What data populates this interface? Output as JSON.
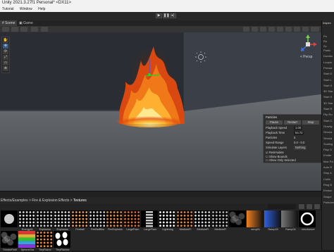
{
  "window": {
    "title": "Unity 2021.3.27f1 Personal* <DX11>"
  },
  "menu": [
    "Tutorial",
    "Window",
    "Help"
  ],
  "scene_tabs": [
    {
      "label": "Scene"
    },
    {
      "label": "Game"
    }
  ],
  "gizmo": {
    "view_label": "< Persp"
  },
  "particles_panel": {
    "title": "Particles",
    "buttons": [
      "Pause",
      "Restart",
      "Stop"
    ],
    "rows": [
      {
        "label": "Playback Speed",
        "value": "1.00"
      },
      {
        "label": "Playback Time",
        "value": "54.72"
      },
      {
        "label": "Particles",
        "value": "5"
      },
      {
        "label": "Speed Range",
        "value": "0.0 - 0.0"
      },
      {
        "label": "Simulate Layers",
        "value": "Nothing"
      }
    ],
    "checks": [
      {
        "label": "Resimulate",
        "checked": true
      },
      {
        "label": "Show Bounds",
        "checked": false
      },
      {
        "label": "Show Only Selected",
        "checked": false
      }
    ]
  },
  "inspector": {
    "tab": "Inspec",
    "items": [
      "Po",
      "Ro",
      "Sc",
      "Partic",
      "Duratio",
      "Loopin",
      "Prewar",
      "Start D",
      "Start L",
      "Start S",
      "3D Star",
      "Start S",
      "3D Star",
      "Start R",
      "Flip Ro",
      "Start C",
      "Gravity",
      "Simula",
      "Simula",
      "Scaling",
      "Play O",
      "Emitte",
      "Max Pa",
      "Auto R",
      "Stop A",
      "Cullin",
      "Ring B",
      "Emissi",
      "Shape",
      "Particles"
    ]
  },
  "project": {
    "breadcrumb": [
      "Effects/Examples",
      "Fire & Explosion Effects",
      "Textures"
    ],
    "assets_row1": [
      {
        "name": "",
        "kind": "sphere",
        "color": "#cccccc"
      },
      {
        "name": "Energy01",
        "kind": "dots",
        "color": "#dddddd"
      },
      {
        "name": "Explosion",
        "kind": "dots",
        "color": "#cccccc"
      },
      {
        "name": "Explosion",
        "kind": "dots",
        "color": "#dddddd"
      },
      {
        "name": "Fireball",
        "kind": "dots",
        "color": "#f2a050"
      },
      {
        "name": "FireBallBlur",
        "kind": "dots",
        "color": "#d0d0d0"
      },
      {
        "name": "FireExplosio",
        "kind": "dots",
        "color": "#e89040"
      },
      {
        "name": "LargeFlam",
        "kind": "dots",
        "color": "#e07030"
      },
      {
        "name": "LargeFlam",
        "kind": "bars",
        "color": "#cccccc"
      },
      {
        "name": "Lightning",
        "kind": "dots",
        "color": "#ffffff"
      },
      {
        "name": "MediumFl",
        "kind": "dots",
        "color": "#e88838"
      },
      {
        "name": "MediumFl",
        "kind": "dots",
        "color": "#d8d8d8"
      },
      {
        "name": "MediumFl",
        "kind": "dots",
        "color": "#bbbbbb"
      },
      {
        "name": "",
        "kind": "smoke",
        "color": "#888888"
      },
      {
        "name": "ramp01",
        "kind": "gradient",
        "color": "#f08020"
      },
      {
        "name": "Ramp03",
        "kind": "gradient",
        "color": "#3060e0"
      },
      {
        "name": "Ramp04",
        "kind": "gradient",
        "color": "#777777"
      },
      {
        "name": "shockwave",
        "kind": "ring",
        "color": "#ffffff"
      }
    ],
    "assets_row2": [
      {
        "name": "SmokeParti",
        "kind": "smoke",
        "color": "#999999"
      },
      {
        "name": "SphereGra",
        "kind": "rainbow",
        "color": "#ffffff"
      },
      {
        "name": "TinyFlame",
        "kind": "dots",
        "color": "#f08c40"
      },
      {
        "name": "TinyFlames",
        "kind": "blobs",
        "color": "#ffffff"
      }
    ]
  }
}
